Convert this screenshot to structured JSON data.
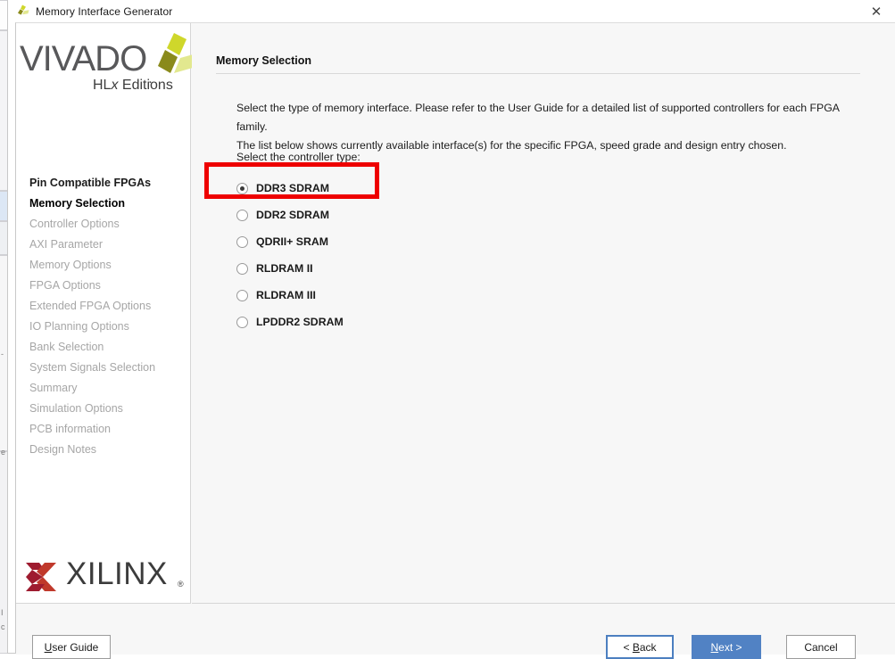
{
  "window": {
    "title": "Memory Interface Generator",
    "title_icon": "vivado-pinwheel-icon",
    "close_label": "✕"
  },
  "sidebar": {
    "logo": {
      "wordmark": "VIVADO",
      "dot": ".",
      "tagline_prefix": "HL",
      "tagline_italic": "x",
      "tagline_suffix": " Editions"
    },
    "items": [
      {
        "label": "Pin Compatible FPGAs",
        "state": "visited"
      },
      {
        "label": "Memory Selection",
        "state": "current"
      },
      {
        "label": "Controller Options",
        "state": "disabled"
      },
      {
        "label": "AXI Parameter",
        "state": "disabled"
      },
      {
        "label": "Memory Options",
        "state": "disabled"
      },
      {
        "label": "FPGA Options",
        "state": "disabled"
      },
      {
        "label": "Extended FPGA Options",
        "state": "disabled"
      },
      {
        "label": "IO Planning Options",
        "state": "disabled"
      },
      {
        "label": "Bank Selection",
        "state": "disabled"
      },
      {
        "label": "System Signals Selection",
        "state": "disabled"
      },
      {
        "label": "Summary",
        "state": "disabled"
      },
      {
        "label": "Simulation Options",
        "state": "disabled"
      },
      {
        "label": "PCB information",
        "state": "disabled"
      },
      {
        "label": "Design Notes",
        "state": "disabled"
      }
    ],
    "vendor_logo": {
      "wordmark": "XILINX",
      "registered": "®"
    }
  },
  "main": {
    "page_title": "Memory Selection",
    "description_line1": "Select the type of memory interface. Please refer to the User Guide for a detailed list of supported controllers for each FPGA family.",
    "description_line2": "The list below shows currently available interface(s) for the specific FPGA, speed grade and design entry chosen.",
    "select_label": "Select the controller type:",
    "controller_options": [
      {
        "label": "DDR3 SDRAM",
        "selected": true
      },
      {
        "label": "DDR2 SDRAM",
        "selected": false
      },
      {
        "label": "QDRII+ SRAM",
        "selected": false
      },
      {
        "label": "RLDRAM II",
        "selected": false
      },
      {
        "label": "RLDRAM III",
        "selected": false
      },
      {
        "label": "LPDDR2 SDRAM",
        "selected": false
      }
    ],
    "annotation": {
      "color": "#ee0000",
      "targets": "DDR3 SDRAM"
    }
  },
  "footer": {
    "user_guide": {
      "mnemonic": "U",
      "rest": "ser Guide"
    },
    "back": {
      "prefix": "< ",
      "mnemonic": "B",
      "rest": "ack"
    },
    "next": {
      "mnemonic": "N",
      "rest": "ext >"
    },
    "cancel": {
      "label": "Cancel"
    }
  },
  "colors": {
    "accent_blue": "#5182c4",
    "focus_blue": "#4c7fc0",
    "annotation_red": "#ee0000",
    "panel_bg": "#f7f7f7",
    "xilinx_red": "#b01c2e"
  }
}
